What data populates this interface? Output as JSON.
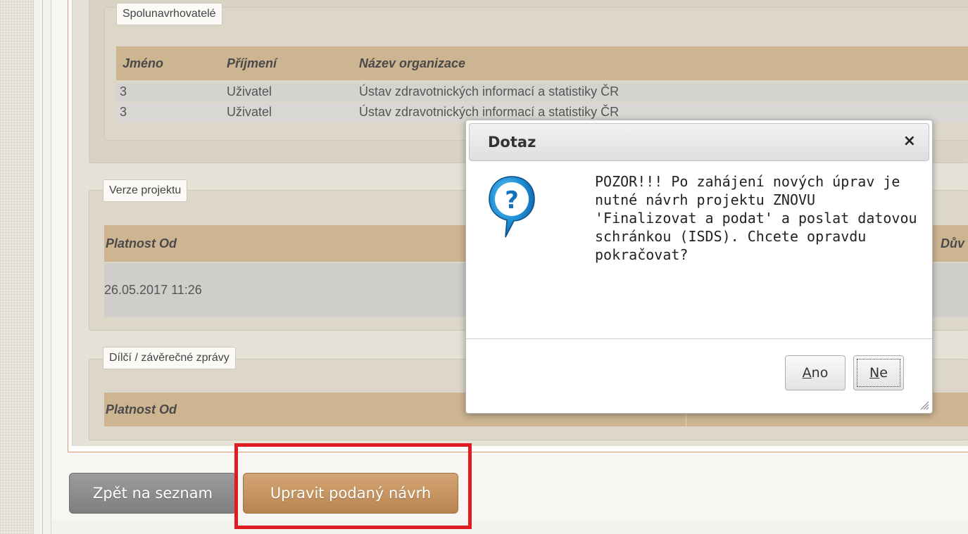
{
  "coproposers": {
    "legend": "Spolunavrhovatelé",
    "columns": [
      "Jméno",
      "Příjmení",
      "Název organizace"
    ],
    "rows": [
      [
        "3",
        "Uživatel",
        "Ústav zdravotnických informací a statistiky ČR"
      ],
      [
        "3",
        "Uživatel",
        "Ústav zdravotnických informací a statistiky ČR"
      ]
    ]
  },
  "versions": {
    "legend": "Verze projektu",
    "columns": [
      "Platnost Od",
      "Dův"
    ],
    "rows": [
      [
        "26.05.2017 11:26"
      ]
    ]
  },
  "reports": {
    "legend": "Dílčí / závěrečné zprávy",
    "columns": [
      "Platnost Od"
    ]
  },
  "buttons": {
    "back": "Zpět na seznam",
    "edit": "Upravit podaný návrh"
  },
  "dialog": {
    "title": "Dotaz",
    "close": "×",
    "icon": "question-icon",
    "message": "POZOR!!! Po zahájení nových úprav je nutné návrh projektu ZNOVU 'Finalizovat a podat' a poslat datovou schránkou (ISDS). Chcete opravdu pokračovat?",
    "yes_key": "A",
    "yes_rest": "no",
    "no_key": "N",
    "no_rest": "e"
  },
  "colors": {
    "header": "#cdb591",
    "highlight": "#e01b24",
    "edit_button": "#c4935f",
    "back_button": "#8d8d8d"
  }
}
